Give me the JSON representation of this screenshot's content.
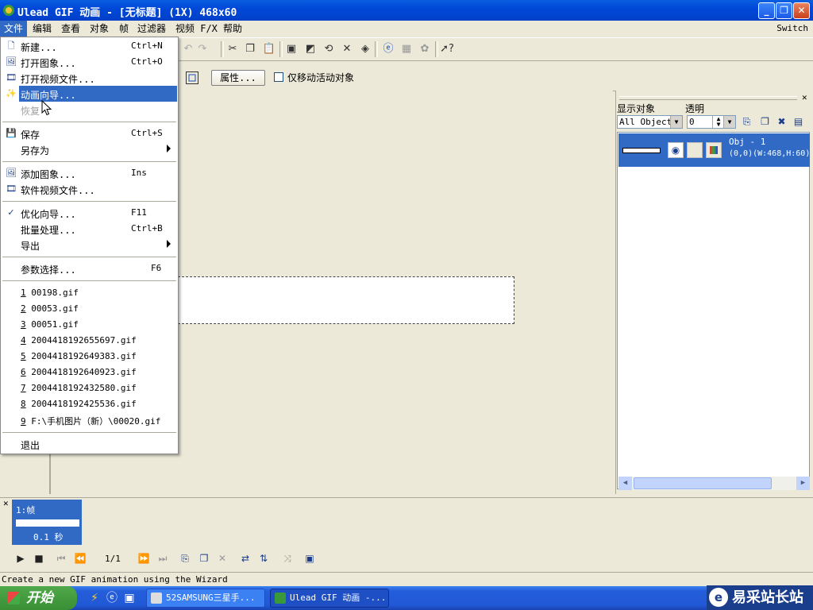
{
  "window": {
    "title": "Ulead GIF 动画 - [无标题] (1X) 468x60",
    "buttons": {
      "minimize": "_",
      "maximize": "❐",
      "close": "✕"
    }
  },
  "menubar": {
    "items": [
      "文件",
      "编辑",
      "查看",
      "对象",
      "帧",
      "过滤器",
      "视频 F/X",
      "帮助"
    ],
    "switch_label": "Switch"
  },
  "toolbar2": {
    "properties_label": "属性...",
    "move_active_only_label": "仅移动活动对象"
  },
  "file_menu": {
    "new": {
      "label": "新建...",
      "shortcut": "Ctrl+N"
    },
    "open_image": {
      "label": "打开图象...",
      "shortcut": "Ctrl+O"
    },
    "open_video": {
      "label": "打开视频文件..."
    },
    "animation_wizard": {
      "label": "动画向导..."
    },
    "revert": {
      "label": "恢复"
    },
    "save": {
      "label": "保存",
      "shortcut": "Ctrl+S"
    },
    "save_as": {
      "label": "另存为"
    },
    "add_image": {
      "label": "添加图象...",
      "shortcut": "Ins"
    },
    "add_video": {
      "label": "软件视频文件..."
    },
    "optimize_wizard": {
      "label": "优化向导...",
      "shortcut": "F11"
    },
    "batch": {
      "label": "批量处理...",
      "shortcut": "Ctrl+B"
    },
    "export": {
      "label": "导出"
    },
    "preferences": {
      "label": "参数选择...",
      "shortcut": "F6"
    },
    "recent": [
      {
        "num": "1",
        "name": " 00198.gif"
      },
      {
        "num": "2",
        "name": " 00053.gif"
      },
      {
        "num": "3",
        "name": " 00051.gif"
      },
      {
        "num": "4",
        "name": " 2004418192655697.gif"
      },
      {
        "num": "5",
        "name": " 2004418192649383.gif"
      },
      {
        "num": "6",
        "name": " 2004418192640923.gif"
      },
      {
        "num": "7",
        "name": " 2004418192432580.gif"
      },
      {
        "num": "8",
        "name": " 2004418192425536.gif"
      },
      {
        "num": "9",
        "name": " F:\\手机图片（新）\\00020.gif"
      }
    ],
    "exit": {
      "label": "退出"
    }
  },
  "object_panel": {
    "show_objects_label": "显示对象",
    "transparency_label": "透明",
    "show_objects_value": "All Objects",
    "transparency_value": "0",
    "object": {
      "name": "Obj - 1",
      "geometry": "(0,0)(W:468,H:60)"
    }
  },
  "frame_panel": {
    "frame_label": "1:帧",
    "frame_delay": "0.1 秒",
    "frame_counter": "1/1"
  },
  "statusbar": {
    "text": "Create a new GIF animation using the Wizard"
  },
  "taskbar": {
    "start_label": "开始",
    "tasks": [
      "52SAMSUNG三星手...",
      "Ulead GIF 动画 -..."
    ],
    "watermark": "易采站长站"
  },
  "colors": {
    "selection": "#316ac5",
    "titlebar": "#0048d8",
    "face": "#ece9d8"
  }
}
